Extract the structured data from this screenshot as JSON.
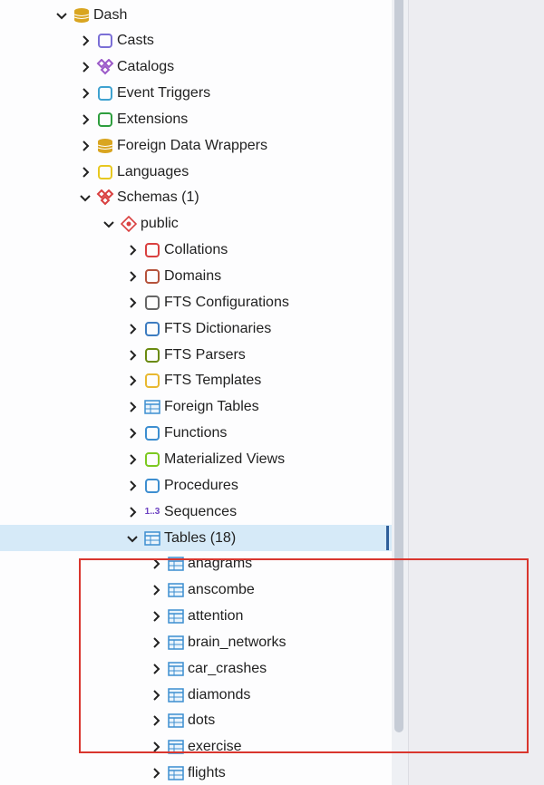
{
  "tree": [
    {
      "label": "Dash",
      "level": 0,
      "expanded": true,
      "icon": "database-icon",
      "color": "#d9a520"
    },
    {
      "label": "Casts",
      "level": 1,
      "icon": "casts-icon",
      "color": "#7b6fd6"
    },
    {
      "label": "Catalogs",
      "level": 1,
      "icon": "catalogs-icon",
      "color": "#9b59c8"
    },
    {
      "label": "Event Triggers",
      "level": 1,
      "icon": "event-triggers-icon",
      "color": "#3fa2d0"
    },
    {
      "label": "Extensions",
      "level": 1,
      "icon": "extensions-icon",
      "color": "#2e9e3e"
    },
    {
      "label": "Foreign Data Wrappers",
      "level": 1,
      "icon": "foreign-data-wrappers-icon",
      "color": "#d9a520"
    },
    {
      "label": "Languages",
      "level": 1,
      "icon": "languages-icon",
      "color": "#e8c820"
    },
    {
      "label": "Schemas (1)",
      "level": 1,
      "expanded": true,
      "icon": "schemas-icon",
      "color": "#d94040"
    },
    {
      "label": "public",
      "level": 2,
      "expanded": true,
      "icon": "schema-icon",
      "color": "#d94040"
    },
    {
      "label": "Collations",
      "level": 3,
      "icon": "collations-icon",
      "color": "#d94040"
    },
    {
      "label": "Domains",
      "level": 3,
      "icon": "domains-icon",
      "color": "#b5523b"
    },
    {
      "label": "FTS Configurations",
      "level": 3,
      "icon": "fts-configurations-icon",
      "color": "#666666"
    },
    {
      "label": "FTS Dictionaries",
      "level": 3,
      "icon": "fts-dictionaries-icon",
      "color": "#3d7cc0"
    },
    {
      "label": "FTS Parsers",
      "level": 3,
      "icon": "fts-parsers-icon",
      "color": "#6a8a10"
    },
    {
      "label": "FTS Templates",
      "level": 3,
      "icon": "fts-templates-icon",
      "color": "#e8b830"
    },
    {
      "label": "Foreign Tables",
      "level": 3,
      "icon": "foreign-tables-icon",
      "color": "#3d8ed0"
    },
    {
      "label": "Functions",
      "level": 3,
      "icon": "functions-icon",
      "color": "#3d8ed0"
    },
    {
      "label": "Materialized Views",
      "level": 3,
      "icon": "materialized-views-icon",
      "color": "#7cc820"
    },
    {
      "label": "Procedures",
      "level": 3,
      "icon": "procedures-icon",
      "color": "#3d8ed0"
    },
    {
      "label": "Sequences",
      "level": 3,
      "icon": "sequences-icon",
      "color": "#6a3fc0",
      "glyph": "1..3"
    },
    {
      "label": "Tables (18)",
      "level": 3,
      "expanded": true,
      "selected": true,
      "icon": "tables-icon",
      "color": "#3d8ed0"
    },
    {
      "label": "anagrams",
      "level": 4,
      "icon": "table-icon",
      "color": "#3d8ed0"
    },
    {
      "label": "anscombe",
      "level": 4,
      "icon": "table-icon",
      "color": "#3d8ed0"
    },
    {
      "label": "attention",
      "level": 4,
      "icon": "table-icon",
      "color": "#3d8ed0"
    },
    {
      "label": "brain_networks",
      "level": 4,
      "icon": "table-icon",
      "color": "#3d8ed0"
    },
    {
      "label": "car_crashes",
      "level": 4,
      "icon": "table-icon",
      "color": "#3d8ed0"
    },
    {
      "label": "diamonds",
      "level": 4,
      "icon": "table-icon",
      "color": "#3d8ed0"
    },
    {
      "label": "dots",
      "level": 4,
      "icon": "table-icon",
      "color": "#3d8ed0"
    },
    {
      "label": "exercise",
      "level": 4,
      "icon": "table-icon",
      "color": "#3d8ed0"
    },
    {
      "label": "flights",
      "level": 4,
      "icon": "table-icon",
      "color": "#3d8ed0"
    }
  ],
  "highlight_color": "#d9362e"
}
